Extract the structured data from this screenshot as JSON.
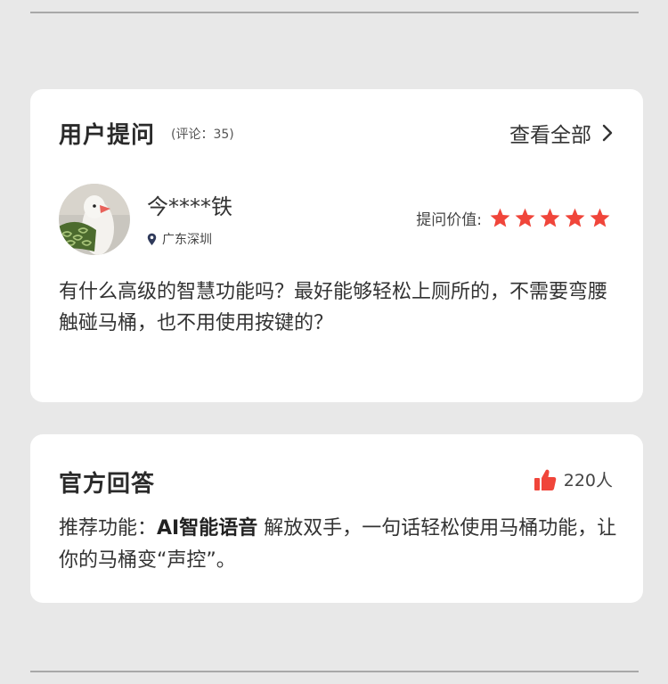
{
  "question_section": {
    "title": "用户提问",
    "comment_count": "(评论：35)",
    "view_all": "查看全部",
    "user": {
      "name": "今****铁",
      "location": "广东深圳"
    },
    "rating_label": "提问价值:",
    "rating": 5,
    "rating_max": 5,
    "question": "有什么高级的智慧功能吗？最好能够轻松上厕所的，不需要弯腰触碰马桶，也不用使用按键的？"
  },
  "answer_section": {
    "title": "官方回答",
    "likes": "220人",
    "answer_prefix": "推荐功能：",
    "answer_highlight": "AI智能语音",
    "answer_rest": " 解放双手，一句话轻松使用马桶功能，让你的马桶变“声控”。"
  },
  "colors": {
    "star": "#f0453a",
    "thumb": "#f0453a",
    "background": "#e8e8e8",
    "card": "#ffffff"
  },
  "icons": [
    "chevron-right-icon",
    "location-pin-icon",
    "star-icon",
    "thumbs-up-icon"
  ]
}
